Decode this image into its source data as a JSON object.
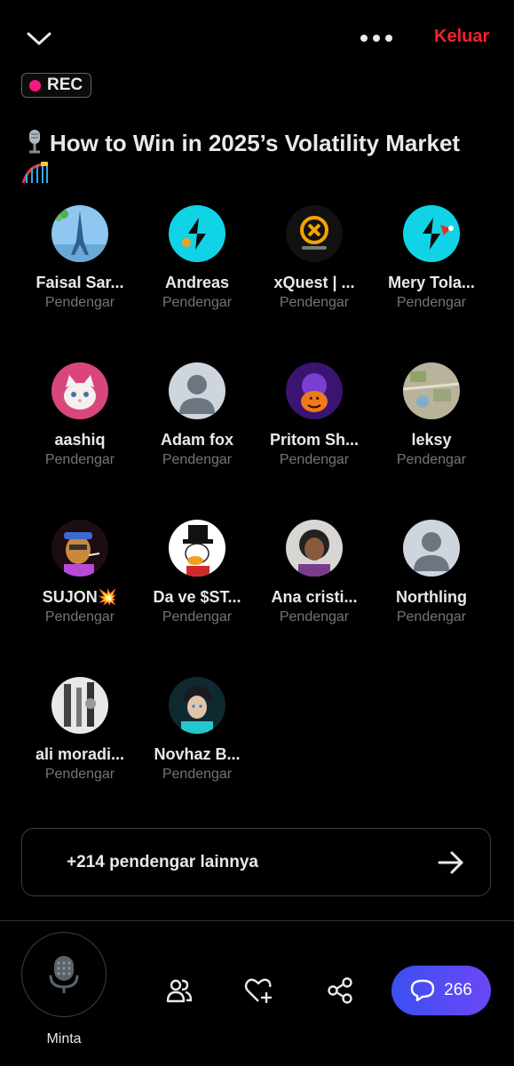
{
  "header": {
    "leave_label": "Keluar"
  },
  "rec_label": "REC",
  "space": {
    "title": "How to Win in 2025’s Volatility Market"
  },
  "listeners": [
    {
      "name": "Faisal Sar...",
      "role": "Pendengar",
      "avatar": "eiffel-tower"
    },
    {
      "name": "Andreas",
      "role": "Pendengar",
      "avatar": "cyan-logo-coin"
    },
    {
      "name": "xQuest | ...",
      "role": "Pendengar",
      "avatar": "orange-x-coin"
    },
    {
      "name": "Mery Tola...",
      "role": "Pendengar",
      "avatar": "cyan-logo-hat"
    },
    {
      "name": "aashiq",
      "role": "Pendengar",
      "avatar": "white-kitten"
    },
    {
      "name": "Adam fox",
      "role": "Pendengar",
      "avatar": "default-person"
    },
    {
      "name": "Pritom Sh...",
      "role": "Pendengar",
      "avatar": "halloween-pumpkin"
    },
    {
      "name": "leksy",
      "role": "Pendengar",
      "avatar": "map-aerial"
    },
    {
      "name": "SUJON💥",
      "role": "Pendengar",
      "avatar": "ape-smoking"
    },
    {
      "name": "Da ve $ST...",
      "role": "Pendengar",
      "avatar": "duck-top-hat"
    },
    {
      "name": "Ana cristi...",
      "role": "Pendengar",
      "avatar": "woman-photo"
    },
    {
      "name": "Northling",
      "role": "Pendengar",
      "avatar": "default-person"
    },
    {
      "name": "ali moradi...",
      "role": "Pendengar",
      "avatar": "bw-figures"
    },
    {
      "name": "Novhaz B...",
      "role": "Pendengar",
      "avatar": "anime-boy"
    }
  ],
  "more_listeners_label": "+214 pendengar lainnya",
  "bottom": {
    "request_label": "Minta",
    "comments_count": "266"
  },
  "colors": {
    "accent_red": "#f4212e",
    "rec_dot": "#f91880",
    "comments_bg": "#4c4cf2",
    "muted": "#71767b"
  }
}
